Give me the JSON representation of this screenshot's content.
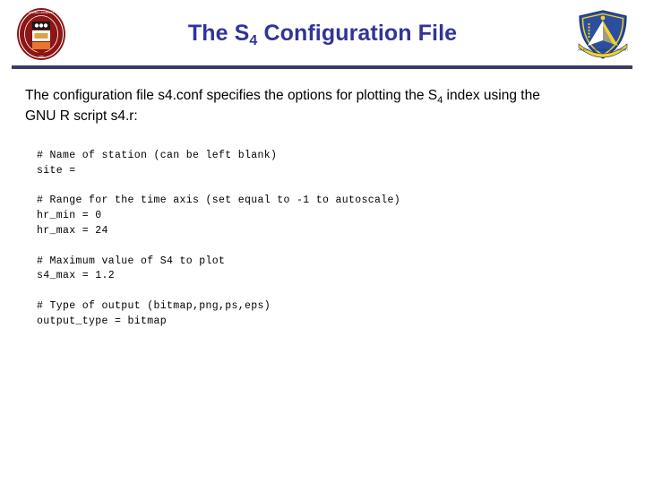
{
  "slide": {
    "title_prefix": "The S",
    "title_sub": "4",
    "title_suffix": " Configuration File",
    "title_full": "The S4 Configuration File",
    "title_color": "#333399",
    "divider_color": "#39396b",
    "background_color": "#ffffff"
  },
  "logos": {
    "left": {
      "name": "cornell-university-seal",
      "primary_color": "#8c1515",
      "accent_color": "#ffffff"
    },
    "right": {
      "name": "air-force-research-laboratory-shield",
      "primary_color": "#2b4f9e",
      "accent_color": "#f2d32b"
    }
  },
  "intro": {
    "line1_a": "The configuration file s4.conf specifies the options for plotting the S",
    "line1_sub": "4",
    "line1_b": " index using the",
    "line2": "GNU R script s4.r:"
  },
  "code": {
    "lines": [
      "# Name of station (can be left blank)",
      "site =",
      "",
      "# Range for the time axis (set equal to -1 to autoscale)",
      "hr_min = 0",
      "hr_max = 24",
      "",
      "# Maximum value of S4 to plot",
      "s4_max = 1.2",
      "",
      "# Type of output (bitmap,png,ps,eps)",
      "output_type = bitmap"
    ]
  }
}
